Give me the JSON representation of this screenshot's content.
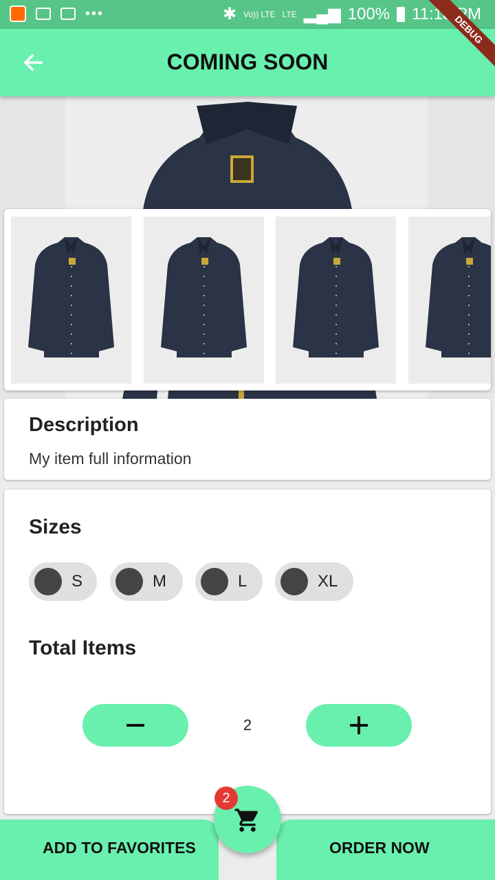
{
  "status_bar": {
    "volte_label": "Vo)) LTE",
    "lte_label": "LTE",
    "battery": "100%",
    "time": "11:18 PM"
  },
  "debug_banner": "DEBUG",
  "app_bar": {
    "title": "COMING SOON",
    "back_icon": "arrow-back-icon"
  },
  "gallery": {
    "thumbnail_count": 4,
    "product_colors": {
      "jacket": "#2b3346",
      "jacket_shadow": "#1f2535",
      "label": "#c8a83a"
    }
  },
  "description": {
    "title": "Description",
    "text": "My item full information"
  },
  "sizes": {
    "title": "Sizes",
    "options": [
      {
        "label": "S"
      },
      {
        "label": "M"
      },
      {
        "label": "L"
      },
      {
        "label": "XL"
      }
    ]
  },
  "total_items": {
    "title": "Total Items",
    "quantity": "2",
    "decrement_icon": "minus-icon",
    "increment_icon": "plus-icon"
  },
  "bottom_bar": {
    "add_to_favorites": "ADD TO FAVORITES",
    "order_now": "ORDER NOW"
  },
  "cart": {
    "icon": "cart-icon",
    "badge_count": "2"
  },
  "colors": {
    "accent": "#69f0ae",
    "status_bar": "#56c587",
    "badge": "#e53935",
    "chip_bg": "#e0e0e0",
    "chip_dot": "#444444"
  }
}
